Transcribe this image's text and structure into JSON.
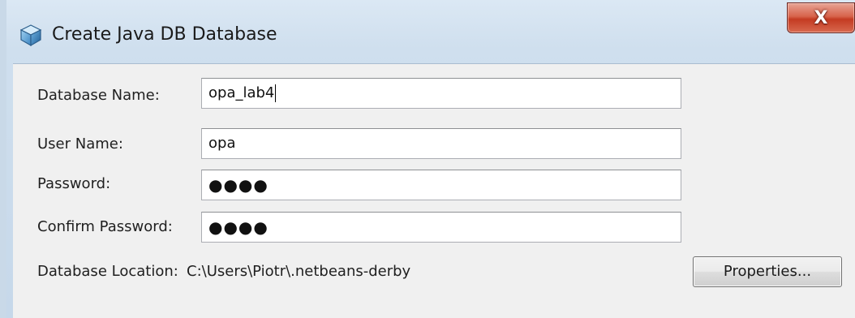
{
  "window": {
    "title": "Create Java DB Database",
    "close_label": "X"
  },
  "form": {
    "database_name": {
      "label": "Database Name:",
      "value": "opa_lab4"
    },
    "user_name": {
      "label": "User Name:",
      "value": "opa"
    },
    "password": {
      "label": "Password:",
      "masked_value": "●●●●"
    },
    "confirm_password": {
      "label": "Confirm Password:",
      "masked_value": "●●●●"
    },
    "database_location": {
      "label": "Database Location:",
      "value": "C:\\Users\\Piotr\\.netbeans-derby"
    },
    "properties_button": "Properties..."
  },
  "colors": {
    "dialog_background": "#f0f0f0",
    "close_button": "#c43b22",
    "frame": "#cfdfee"
  }
}
